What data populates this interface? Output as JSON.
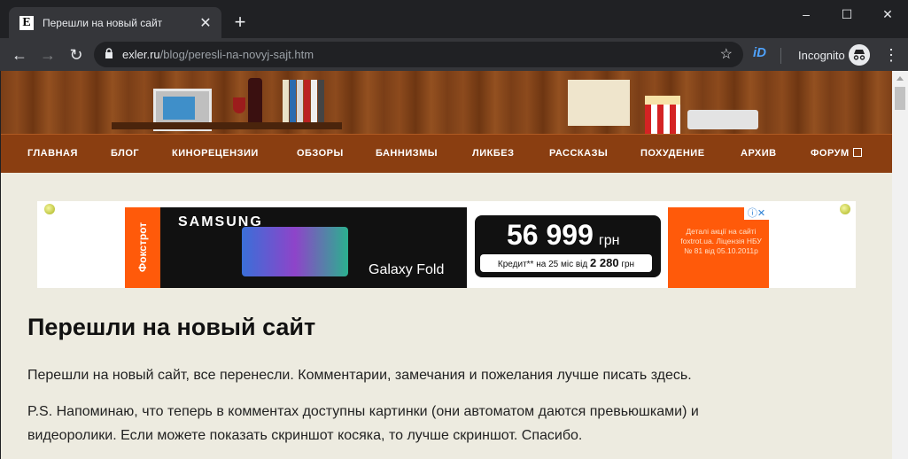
{
  "browser": {
    "tab": {
      "favicon": "E",
      "title": "Перешли на новый сайт"
    },
    "window_controls": {
      "minimize": "–",
      "maximize": "☐",
      "close": "✕"
    },
    "url": {
      "host": "exler.ru",
      "path": "/blog/peresli-na-novyj-sajt.htm"
    },
    "incognito_label": "Incognito",
    "extension_icon": "iD"
  },
  "nav": {
    "items": [
      "ГЛАВНАЯ",
      "БЛОГ",
      "КИНОРЕЦЕНЗИИ",
      "ОБЗОРЫ",
      "БАННИЗМЫ",
      "ЛИКБЕЗ",
      "РАССКАЗЫ",
      "ПОХУДЕНИЕ",
      "АРХИВ",
      "ФОРУМ"
    ]
  },
  "ad": {
    "store": "Фокстрот",
    "brand": "SAMSUNG",
    "product": "Galaxy Fold",
    "price": "56 999",
    "currency": "грн",
    "credit_prefix": "Кредит** на 25 міс від",
    "credit_amount": "2 280",
    "credit_currency": "грн",
    "fine_print": "Деталі акції на сайті foxtrot.ua. Ліцензія НБУ № 81 від 05.10.2011р"
  },
  "article": {
    "title": "Перешли на новый сайт",
    "p1": "Перешли на новый сайт, все перенесли. Комментарии, замечания и пожелания лучше писать здесь.",
    "p2_line1": "P.S. Напоминаю, что теперь в комментах доступны картинки (они автоматом даются превьюшками) и",
    "p2_line2": "видеоролики. Если можете показать скриншот косяка, то лучше скриншот. Спасибо."
  },
  "colors": {
    "nav_bg": "#8a3e11",
    "page_bg": "#edebe0",
    "ad_orange": "#ff5a0a"
  }
}
